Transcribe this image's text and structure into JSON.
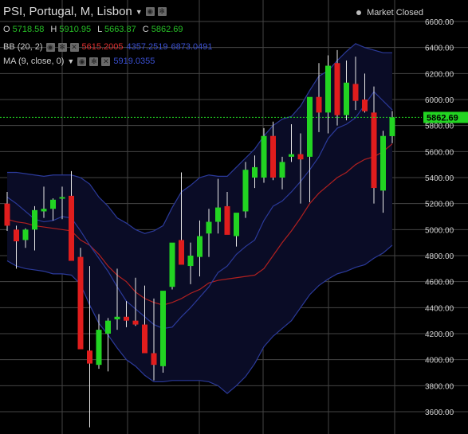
{
  "header": {
    "title": "PSI, Portugal, M, Lisbon",
    "status": "Market Closed",
    "ohlc": [
      {
        "k": "O",
        "v": "5718.58"
      },
      {
        "k": "H",
        "v": "5910.95"
      },
      {
        "k": "L",
        "v": "5663.87"
      },
      {
        "k": "C",
        "v": "5862.69"
      }
    ]
  },
  "indicators": {
    "bb": {
      "label": "BB (20, 2)",
      "values": [
        "5615.2005",
        "4357.2519",
        "6873.0491"
      ],
      "colors": [
        "#e03030",
        "#3a4fd0",
        "#3a4fd0"
      ]
    },
    "ma": {
      "label": "MA (9, close, 0)",
      "value": "5919.0355",
      "color": "#3a4fd0"
    }
  },
  "colors": {
    "up": "#22d422",
    "down": "#e01d1d",
    "grid": "#444444",
    "band_fill": "#0a0c26",
    "bb_outer": "#2b3a9a",
    "bb_mid": "#b02020",
    "ma": "#2b3a9a",
    "price_line": "#22d422",
    "price_label_bg": "#22d422"
  },
  "chart_data": {
    "type": "candlestick",
    "current_price": "5862.69",
    "y_ticks": [
      "6600.00",
      "6400.00",
      "6200.00",
      "6000.00",
      "5800.00",
      "5600.00",
      "5400.00",
      "5200.00",
      "5000.00",
      "4800.00",
      "4600.00",
      "4400.00",
      "4200.00",
      "4000.00",
      "3800.00",
      "3600.00"
    ],
    "ylim": [
      3500,
      6680
    ],
    "candles": [
      {
        "o": 5200,
        "h": 5290,
        "l": 4990,
        "c": 5030
      },
      {
        "o": 5000,
        "h": 5030,
        "l": 4700,
        "c": 4910
      },
      {
        "o": 4920,
        "h": 5010,
        "l": 4860,
        "c": 5000
      },
      {
        "o": 5000,
        "h": 5180,
        "l": 4840,
        "c": 5150
      },
      {
        "o": 5140,
        "h": 5330,
        "l": 5090,
        "c": 5160
      },
      {
        "o": 5160,
        "h": 5240,
        "l": 5070,
        "c": 5230
      },
      {
        "o": 5240,
        "h": 5330,
        "l": 5080,
        "c": 5250
      },
      {
        "o": 5260,
        "h": 5450,
        "l": 4840,
        "c": 4760
      },
      {
        "o": 4790,
        "h": 4860,
        "l": 4170,
        "c": 4080
      },
      {
        "o": 4070,
        "h": 4720,
        "l": 3480,
        "c": 3970
      },
      {
        "o": 3960,
        "h": 4350,
        "l": 3930,
        "c": 4230
      },
      {
        "o": 4200,
        "h": 4320,
        "l": 3910,
        "c": 4300
      },
      {
        "o": 4310,
        "h": 4700,
        "l": 4230,
        "c": 4330
      },
      {
        "o": 4330,
        "h": 4450,
        "l": 4250,
        "c": 4300
      },
      {
        "o": 4300,
        "h": 4630,
        "l": 4260,
        "c": 4270
      },
      {
        "o": 4270,
        "h": 4570,
        "l": 4220,
        "c": 4050
      },
      {
        "o": 4050,
        "h": 4470,
        "l": 3840,
        "c": 3960
      },
      {
        "o": 3950,
        "h": 4500,
        "l": 3900,
        "c": 4530
      },
      {
        "o": 4560,
        "h": 4880,
        "l": 4540,
        "c": 4900
      },
      {
        "o": 4920,
        "h": 5440,
        "l": 4790,
        "c": 4730
      },
      {
        "o": 4720,
        "h": 4900,
        "l": 4580,
        "c": 4800
      },
      {
        "o": 4790,
        "h": 5070,
        "l": 4640,
        "c": 4950
      },
      {
        "o": 4970,
        "h": 5160,
        "l": 4790,
        "c": 5060
      },
      {
        "o": 5060,
        "h": 5390,
        "l": 4970,
        "c": 5170
      },
      {
        "o": 5180,
        "h": 5290,
        "l": 5130,
        "c": 4960
      },
      {
        "o": 4950,
        "h": 5110,
        "l": 4870,
        "c": 5130
      },
      {
        "o": 5140,
        "h": 5520,
        "l": 5090,
        "c": 5460
      },
      {
        "o": 5400,
        "h": 5570,
        "l": 5320,
        "c": 5480
      },
      {
        "o": 5400,
        "h": 5780,
        "l": 5360,
        "c": 5720
      },
      {
        "o": 5720,
        "h": 5830,
        "l": 5380,
        "c": 5400
      },
      {
        "o": 5400,
        "h": 5560,
        "l": 5310,
        "c": 5520
      },
      {
        "o": 5560,
        "h": 5810,
        "l": 5520,
        "c": 5580
      },
      {
        "o": 5580,
        "h": 5740,
        "l": 5200,
        "c": 5540
      },
      {
        "o": 5560,
        "h": 5740,
        "l": 5210,
        "c": 6020
      },
      {
        "o": 6020,
        "h": 6280,
        "l": 5750,
        "c": 5900
      },
      {
        "o": 5900,
        "h": 6340,
        "l": 5740,
        "c": 6260
      },
      {
        "o": 6280,
        "h": 6380,
        "l": 5800,
        "c": 5880
      },
      {
        "o": 5880,
        "h": 6300,
        "l": 5840,
        "c": 6130
      },
      {
        "o": 6120,
        "h": 6330,
        "l": 5920,
        "c": 5990
      },
      {
        "o": 6000,
        "h": 6200,
        "l": 5900,
        "c": 5910
      },
      {
        "o": 5900,
        "h": 6100,
        "l": 5200,
        "c": 5320
      },
      {
        "o": 5300,
        "h": 5760,
        "l": 5130,
        "c": 5720
      },
      {
        "o": 5718.58,
        "h": 5910.95,
        "l": 5663.87,
        "c": 5862.69
      }
    ],
    "bb_upper": [
      5440,
      5440,
      5430,
      5420,
      5410,
      5420,
      5420,
      5420,
      5400,
      5350,
      5250,
      5180,
      5090,
      5050,
      5000,
      4970,
      4990,
      5030,
      5170,
      5290,
      5340,
      5400,
      5420,
      5410,
      5410,
      5480,
      5550,
      5620,
      5720,
      5800,
      5850,
      5870,
      5950,
      6070,
      6180,
      6220,
      6300,
      6370,
      6430,
      6400,
      6380,
      6360,
      6360
    ],
    "bb_lower": [
      4760,
      4720,
      4700,
      4690,
      4680,
      4660,
      4660,
      4650,
      4580,
      4420,
      4280,
      4190,
      4090,
      4000,
      3950,
      3880,
      3830,
      3830,
      3840,
      3840,
      3840,
      3840,
      3830,
      3800,
      3740,
      3800,
      3870,
      3970,
      4100,
      4180,
      4240,
      4300,
      4400,
      4500,
      4570,
      4620,
      4660,
      4680,
      4710,
      4730,
      4780,
      4820,
      4880
    ],
    "bb_middle": [
      5080,
      5060,
      5050,
      5030,
      5020,
      5010,
      5000,
      4990,
      4920,
      4880,
      4810,
      4720,
      4650,
      4600,
      4520,
      4470,
      4440,
      4420,
      4440,
      4470,
      4510,
      4540,
      4590,
      4610,
      4620,
      4630,
      4640,
      4650,
      4700,
      4800,
      4900,
      4990,
      5090,
      5200,
      5280,
      5340,
      5400,
      5440,
      5500,
      5540,
      5560,
      5600,
      5660
    ],
    "ma": [
      5250,
      5200,
      5140,
      5080,
      5060,
      5070,
      5100,
      5090,
      4990,
      4880,
      4780,
      4680,
      4560,
      4450,
      4390,
      4330,
      4270,
      4240,
      4250,
      4330,
      4400,
      4480,
      4560,
      4670,
      4720,
      4810,
      4870,
      4920,
      5070,
      5180,
      5220,
      5290,
      5370,
      5460,
      5560,
      5700,
      5780,
      5810,
      5860,
      5960,
      6060,
      5990,
      5920
    ]
  }
}
